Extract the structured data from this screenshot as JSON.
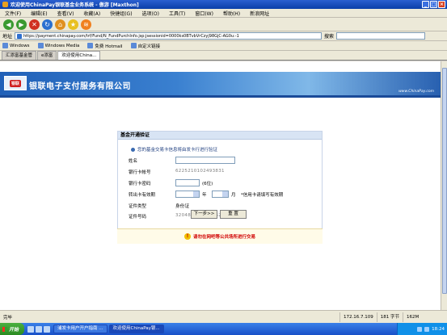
{
  "window": {
    "title": "欢迎使用ChinaPay银联基金业务系统 - 傲游 [Maxthon]",
    "controls": [
      "_",
      "□",
      "×"
    ]
  },
  "menu": [
    "文件(F)",
    "编辑(E)",
    "查看(V)",
    "收藏(A)",
    "快捷组(G)",
    "选项(O)",
    "工具(T)",
    "窗口(W)",
    "帮助(H)",
    "新浪网址"
  ],
  "toolbar": {
    "icons": [
      "back-icon",
      "forward-icon",
      "stop-icon",
      "refresh-icon",
      "home-icon",
      "favorites-icon",
      "rss-icon"
    ],
    "colors": {
      "back": "#3a9a30",
      "forward": "#3a9a30",
      "stop": "#d03020",
      "refresh": "#2a70d0",
      "home": "#e09020"
    }
  },
  "address": {
    "label": "地址",
    "url": "https://payment.chinapay.com/trf/Fund/N_FundPurchInfo.jsp;jsessionid=0000ks0BTvbVrCzyj98GjC-AG0u:-1",
    "search_label": "搜索"
  },
  "links": [
    "Windows",
    "Windows Media",
    "免费 Hotmail",
    "自定义链接"
  ],
  "tabs": [
    {
      "label": "汇添富基金管",
      "active": false
    },
    {
      "label": "e添富",
      "active": false
    },
    {
      "label": "欢迎使用China...",
      "active": true
    }
  ],
  "banner": {
    "logo_text": "银联",
    "brand": "银联电子支付服务有限公司",
    "site": "www.ChinaPay.com"
  },
  "form": {
    "title": "基金开通验证",
    "notice": "您的基金交易卡信息将由发卡行进行验证",
    "fields": {
      "name_label": "姓名",
      "card_label": "银行卡帐号",
      "card_value": "6225210102493831",
      "password_label": "银行卡密码",
      "password_hint": "(6位)",
      "expiry_label": "转出卡有效期",
      "year_unit": "年",
      "month_unit": "月",
      "expiry_note": "*信用卡请填写有效期",
      "idtype_label": "证件类型",
      "idtype_value": "身份证",
      "idnum_label": "证件号码",
      "idnum_value": "320481198111062211"
    },
    "next_button": "下一步>>",
    "reset_button": "重 置",
    "warning": "请勿在网吧等公共场所进行交易"
  },
  "status": {
    "text": "完毕",
    "ip": "172.16.7.109",
    "bytes": "181 字节",
    "mem": "162M"
  },
  "taskbar": {
    "start": "开始",
    "tasks": [
      {
        "label": "浦发卡用户开户指南 ...",
        "active": false
      },
      {
        "label": "欢迎使用ChinaPay银...",
        "active": true
      }
    ],
    "clock": "18:24"
  }
}
